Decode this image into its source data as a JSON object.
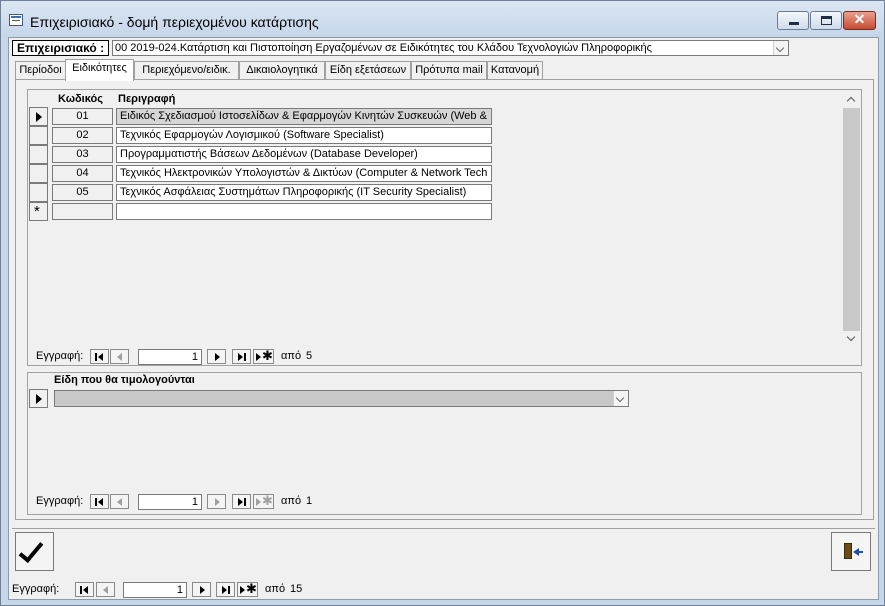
{
  "window": {
    "title": "Επιχειρισιακό - δομή περιεχομένου κατάρτισης"
  },
  "header": {
    "label": "Επιχειρισιακό :",
    "combo_value": "00 2019-024.Κατάρτιση και Πιστοποίηση Εργαζομένων σε Ειδικότητες του Κλάδου Τεχνολογιών Πληροφορικής"
  },
  "tabs": [
    {
      "label": "Περίοδοι"
    },
    {
      "label": "Ειδικότητες"
    },
    {
      "label": "Περιεχόμενο/ειδικ."
    },
    {
      "label": "Δικαιολογητικά"
    },
    {
      "label": "Είδη εξετάσεων"
    },
    {
      "label": "Πρότυπα mail"
    },
    {
      "label": "Κατανομή"
    }
  ],
  "grid": {
    "col_code": "Κωδικός",
    "col_desc": "Περιγραφή",
    "rows": [
      {
        "code": "01",
        "desc": "Ειδικός Σχεδιασμού Ιστοσελίδων & Εφαρμογών Κινητών Συσκευών (Web &"
      },
      {
        "code": "02",
        "desc": "Τεχνικός Εφαρμογών Λογισμικού (Software Specialist)"
      },
      {
        "code": "03",
        "desc": "Προγραμματιστής Βάσεων Δεδομένων (Database Developer)"
      },
      {
        "code": "04",
        "desc": "Τεχνικός Ηλεκτρονικών Υπολογιστών & Δικτύων (Computer & Network Tech"
      },
      {
        "code": "05",
        "desc": "Τεχνικός Ασφάλειας Συστημάτων Πληροφορικής (IT Security Specialist)"
      }
    ],
    "new_row_marker": "*"
  },
  "nav1": {
    "label": "Εγγραφή:",
    "record": "1",
    "of": "από",
    "total": "5"
  },
  "subform2": {
    "title": "Είδη που θα τιμολογούνται"
  },
  "nav2": {
    "label": "Εγγραφή:",
    "record": "1",
    "of": "από",
    "total": "1"
  },
  "mainnav": {
    "label": "Εγγραφή:",
    "record": "1",
    "of": "από",
    "total": "15"
  },
  "icons": {
    "ok": "checkmark-icon",
    "exit": "exit-door-icon"
  }
}
